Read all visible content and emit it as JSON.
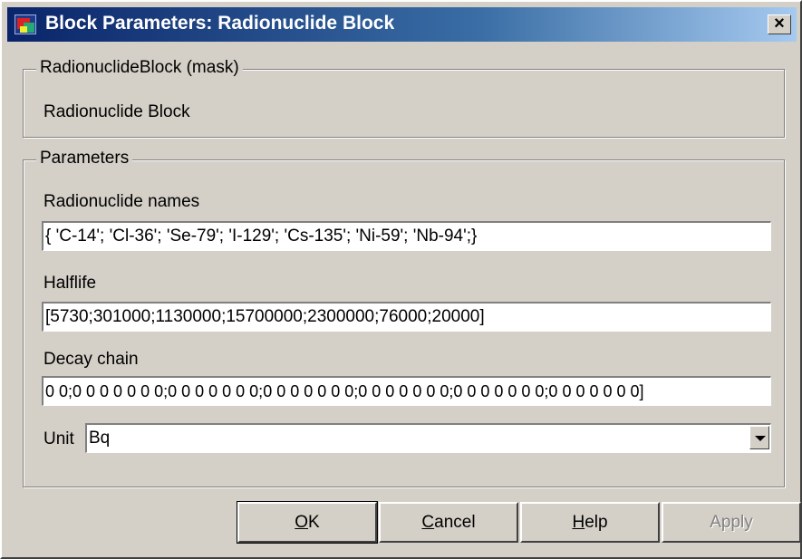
{
  "window": {
    "title": "Block Parameters: Radionuclide Block",
    "close_label": "×"
  },
  "mask_group": {
    "legend": "RadionuclideBlock (mask)",
    "description": "Radionuclide Block"
  },
  "params_group": {
    "legend": "Parameters",
    "fields": {
      "names": {
        "label": "Radionuclide names",
        "value": "{ 'C-14'; 'Cl-36'; 'Se-79'; 'I-129'; 'Cs-135'; 'Ni-59'; 'Nb-94';}"
      },
      "halflife": {
        "label": "Halflife",
        "value": "[5730;301000;1130000;15700000;2300000;76000;20000]"
      },
      "decay_chain": {
        "label": "Decay chain",
        "value": "0 0;0 0 0 0 0 0 0;0 0 0 0 0 0 0;0 0 0 0 0 0 0;0 0 0 0 0 0 0;0 0 0 0 0 0 0;0 0 0 0 0 0 0]"
      },
      "unit": {
        "label": "Unit",
        "value": "Bq"
      }
    }
  },
  "buttons": {
    "ok": {
      "mnemonic": "O",
      "rest": "K"
    },
    "cancel": {
      "mnemonic": "C",
      "rest": "ancel"
    },
    "help": {
      "mnemonic": "H",
      "rest": "elp"
    },
    "apply": {
      "label": "Apply"
    }
  }
}
